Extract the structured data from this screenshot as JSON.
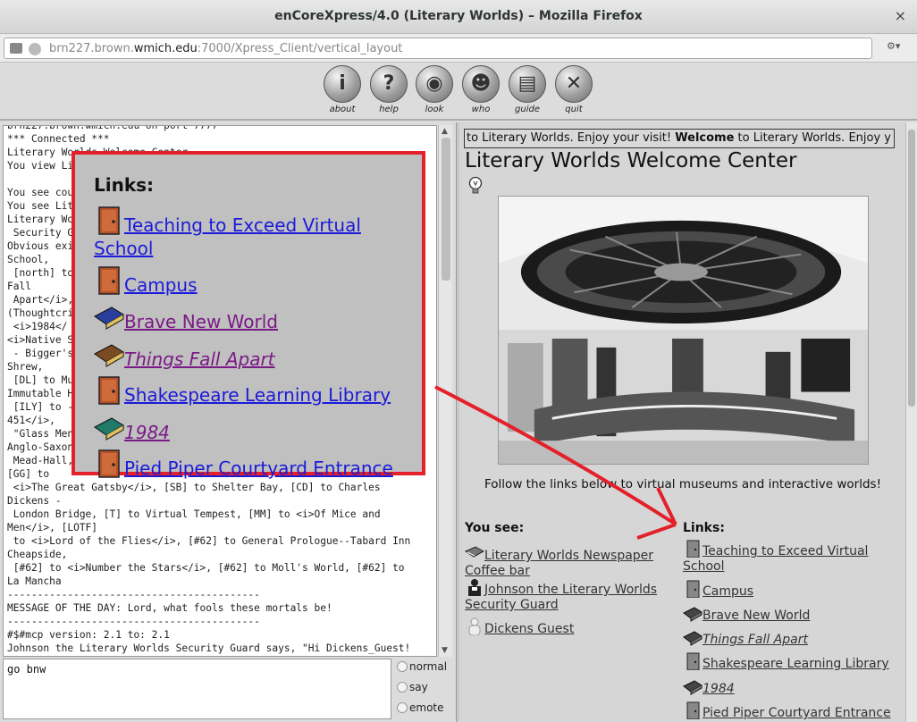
{
  "window": {
    "title": "enCoreXpress/4.0 (Literary Worlds) – Mozilla Firefox",
    "close_glyph": "×"
  },
  "urlbar": {
    "prefix": "brn227.brown.",
    "domain": "wmich.edu",
    "suffix": ":7000/Xpress_Client/vertical_layout"
  },
  "toolbar": {
    "buttons": [
      {
        "label": "about",
        "glyph": "i"
      },
      {
        "label": "help",
        "glyph": "?"
      },
      {
        "label": "look",
        "glyph": "◉"
      },
      {
        "label": "who",
        "glyph": "☻"
      },
      {
        "label": "guide",
        "glyph": "▤"
      },
      {
        "label": "quit",
        "glyph": "✕"
      }
    ]
  },
  "log": {
    "lines": [
      "brn227.brown.wmich.edu on port 7777",
      "*** Connected ***",
      "Literary Worlds Welcome Center",
      "You view Literary Worlds Welcome Center.",
      "",
      "You see coul",
      "You see Lit",
      "Literary Wor",
      " Security G",
      "Obvious exi                                                   l",
      "School,",
      " [north] to",
      "Fall",
      " Apart</i>,",
      "(Thoughtcri",
      " <i>1984</",
      "<i>Native S",
      " - Bigger's                                                   e",
      "Shrew,",
      " [DL] to Mu",
      "Immutable H",
      " [ILY] to -",
      "451</i>, ",
      " \"Glass Men",
      "Anglo-Saxon",
      " Mead-Hall,",
      "[GG] to",
      " <i>The Great Gatsby</i>, [SB] to Shelter Bay, [CD] to Charles",
      "Dickens -",
      " London Bridge, [T] to Virtual Tempest, [MM] to <i>Of Mice and",
      "Men</i>, [LOTF]",
      " to <i>Lord of the Flies</i>, [#62] to General Prologue--Tabard Inn",
      "Cheapside,",
      " [#62] to <i>Number the Stars</i>, [#62] to Moll's World, [#62] to",
      "La Mancha",
      "------------------------------------------",
      "MESSAGE OF THE DAY: Lord, what fools these mortals be!",
      "------------------------------------------",
      "#$#mcp version: 2.1 to: 2.1",
      "Johnson the Literary Worlds Security Guard says, \"Hi Dickens_Guest!"
    ]
  },
  "input": {
    "value": "go bnw",
    "modes": [
      "normal",
      "say",
      "emote"
    ]
  },
  "right": {
    "marquee_prefix": "to Literary Worlds. Enjoy your visit! ",
    "marquee_bold": "Welcome",
    "marquee_suffix": " to Literary Worlds. Enjoy y",
    "room_title": "Literary Worlds Welcome Center",
    "follow_text": "Follow the links below to virtual museums and interactive worlds!",
    "you_see_heading": "You see:",
    "links_heading": "Links:",
    "you_see": [
      {
        "label": "Literary Worlds Newspaper Coffee bar",
        "icon": "newspaper-icon"
      },
      {
        "label": "Johnson the Literary Worlds Security Guard",
        "icon": "person-icon"
      },
      {
        "label": "Dickens Guest",
        "icon": "guest-icon"
      }
    ],
    "links": [
      {
        "label": "Teaching to Exceed Virtual School",
        "icon": "door-icon",
        "italic": false
      },
      {
        "label": "Campus",
        "icon": "door-icon",
        "italic": false
      },
      {
        "label": "Brave New World",
        "icon": "book-icon",
        "italic": false
      },
      {
        "label": "Things Fall Apart",
        "icon": "book-icon",
        "italic": true
      },
      {
        "label": "Shakespeare Learning Library",
        "icon": "door-icon",
        "italic": false
      },
      {
        "label": "1984",
        "icon": "book-icon",
        "italic": true
      },
      {
        "label": "Pied Piper Courtyard Entrance",
        "icon": "door-icon",
        "italic": false
      }
    ]
  },
  "overlay": {
    "heading": "Links:",
    "items": [
      {
        "label": "Teaching to Exceed Virtual",
        "label2": "School",
        "icon": "door-icon",
        "color": "blue",
        "italic": false
      },
      {
        "label": "Campus",
        "icon": "door-icon",
        "color": "blue",
        "italic": false
      },
      {
        "label": "Brave New World",
        "icon": "book-icon",
        "color": "purple",
        "italic": false
      },
      {
        "label": "Things Fall Apart",
        "icon": "book-icon",
        "color": "purple",
        "italic": true
      },
      {
        "label": "Shakespeare Learning Library",
        "icon": "door-icon",
        "color": "blue",
        "italic": false
      },
      {
        "label": "1984",
        "icon": "book-icon",
        "color": "purple",
        "italic": true
      },
      {
        "label": "Pied Piper Courtyard Entrance",
        "icon": "door-icon",
        "color": "blue",
        "italic": false
      }
    ]
  },
  "colors": {
    "annotation_red": "#e4202a",
    "link_blue": "#1b1bd9",
    "link_purple": "#7a1a86"
  }
}
